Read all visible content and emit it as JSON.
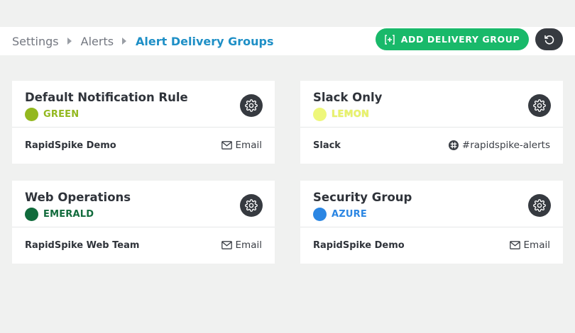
{
  "breadcrumb": {
    "items": [
      {
        "label": "Settings"
      },
      {
        "label": "Alerts"
      },
      {
        "label": "Alert Delivery Groups"
      }
    ]
  },
  "actions": {
    "add_label": "ADD DELIVERY GROUP",
    "add_icon": "plus-square-icon",
    "reset_icon": "reset-icon"
  },
  "colors": {
    "green": "#93b81f",
    "lemon": "#eef77a",
    "emerald": "#116b3c",
    "azure": "#2b86e3",
    "button_green": "#19b96a",
    "link_blue": "#1e8fc6"
  },
  "groups": [
    {
      "title": "Default Notification Rule",
      "color_name": "GREEN",
      "member": "RapidSpike Demo",
      "channel_icon": "envelope-icon",
      "channel": "Email"
    },
    {
      "title": "Slack Only",
      "color_name": "LEMON",
      "member": "Slack",
      "channel_icon": "slack-icon",
      "channel": "#rapidspike-alerts"
    },
    {
      "title": "Web Operations",
      "color_name": "EMERALD",
      "member": "RapidSpike Web Team",
      "channel_icon": "envelope-icon",
      "channel": "Email"
    },
    {
      "title": "Security Group",
      "color_name": "AZURE",
      "member": "RapidSpike Demo",
      "channel_icon": "envelope-icon",
      "channel": "Email"
    }
  ]
}
